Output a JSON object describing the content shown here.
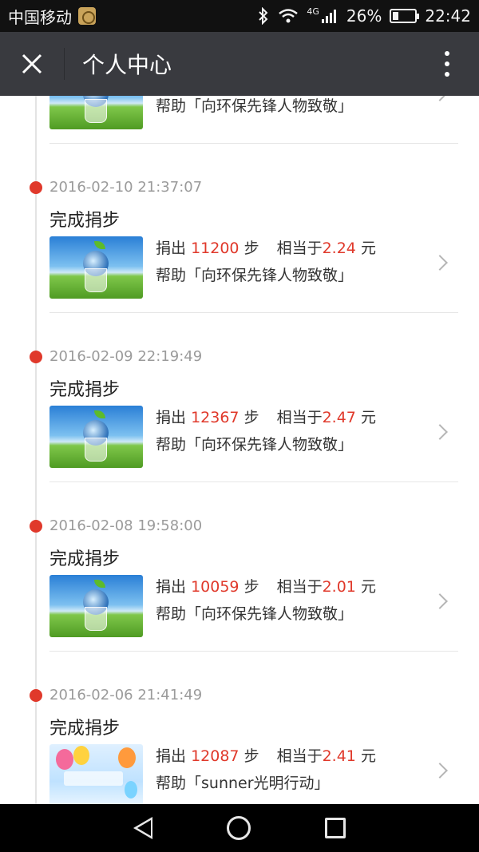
{
  "status_bar": {
    "carrier": "中国移动",
    "network": "4G",
    "battery_percent": "26%",
    "battery_level": 0.26,
    "time": "22:42"
  },
  "nav": {
    "close_icon": "close-icon",
    "title": "个人中心",
    "more_icon": "more-vertical-icon"
  },
  "partial_entry": {
    "help_prefix": "帮助",
    "help_target": "「向环保先锋人物致敬」"
  },
  "entries": [
    {
      "date": "2016-02-10 21:37:07",
      "title": "完成捐步",
      "donate_label": "捐出",
      "steps": "11200",
      "steps_unit": "步",
      "equiv_label": "相当于",
      "amount": "2.24",
      "amount_unit": "元",
      "help_prefix": "帮助",
      "help_target": "「向环保先锋人物致敬」",
      "thumb": "eco-globe"
    },
    {
      "date": "2016-02-09 22:19:49",
      "title": "完成捐步",
      "donate_label": "捐出",
      "steps": "12367",
      "steps_unit": "步",
      "equiv_label": "相当于",
      "amount": "2.47",
      "amount_unit": "元",
      "help_prefix": "帮助",
      "help_target": "「向环保先锋人物致敬」",
      "thumb": "eco-globe"
    },
    {
      "date": "2016-02-08 19:58:00",
      "title": "完成捐步",
      "donate_label": "捐出",
      "steps": "10059",
      "steps_unit": "步",
      "equiv_label": "相当于",
      "amount": "2.01",
      "amount_unit": "元",
      "help_prefix": "帮助",
      "help_target": "「向环保先锋人物致敬」",
      "thumb": "eco-globe"
    },
    {
      "date": "2016-02-06 21:41:49",
      "title": "完成捐步",
      "donate_label": "捐出",
      "steps": "12087",
      "steps_unit": "步",
      "equiv_label": "相当于",
      "amount": "2.41",
      "amount_unit": "元",
      "help_prefix": "帮助",
      "help_target": "「sunner光明行动」",
      "thumb": "balloons"
    }
  ],
  "colors": {
    "accent_red": "#e0392b",
    "nav_bg": "#393a3f",
    "status_bg": "#111111"
  },
  "bottom_nav": {
    "back_icon": "back-triangle-icon",
    "home_icon": "home-circle-icon",
    "recent_icon": "recent-square-icon"
  }
}
